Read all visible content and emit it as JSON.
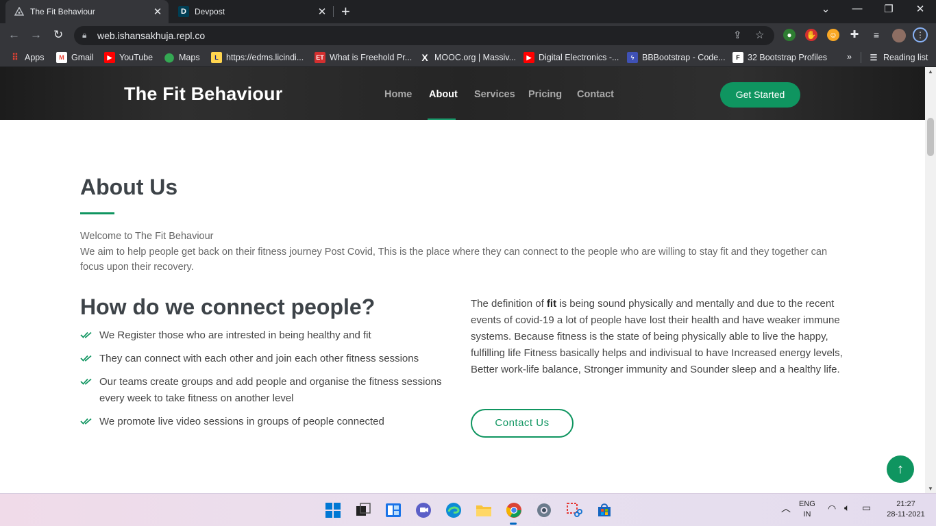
{
  "browser": {
    "tabs": [
      {
        "title": "The Fit Behaviour",
        "active": true
      },
      {
        "title": "Devpost",
        "active": false,
        "favicon_letter": "D"
      }
    ],
    "url": "web.ishansakhuja.repl.co",
    "bookmarks": [
      {
        "label": "Apps",
        "icon": "apps-grid-icon"
      },
      {
        "label": "Gmail",
        "icon": "gmail-icon"
      },
      {
        "label": "YouTube",
        "icon": "youtube-icon"
      },
      {
        "label": "Maps",
        "icon": "maps-icon"
      },
      {
        "label": "https://edms.licindi...",
        "icon": "lic-icon"
      },
      {
        "label": "What is Freehold Pr...",
        "icon": "et-icon",
        "icon_text": "ET"
      },
      {
        "label": "MOOC.org | Massiv...",
        "icon": "mooc-icon",
        "icon_text": "X"
      },
      {
        "label": "Digital Electronics -...",
        "icon": "youtube-icon"
      },
      {
        "label": "BBBootstrap - Code...",
        "icon": "bbbootstrap-icon"
      },
      {
        "label": "32 Bootstrap Profiles",
        "icon": "f-icon",
        "icon_text": "F"
      }
    ],
    "reading_list": "Reading list",
    "more_bookmarks": "»"
  },
  "site": {
    "logo": "The Fit Behaviour",
    "nav": [
      "Home",
      "About",
      "Services",
      "Pricing",
      "Contact"
    ],
    "active_nav": "About",
    "cta": "Get Started"
  },
  "about": {
    "title": "About Us",
    "intro_line1": "Welcome to The Fit Behaviour",
    "intro_line2": "We aim to help people get back on their fitness journey Post Covid, This is the place where they can connect to the people who are willing to stay fit and they together can focus upon their recovery.",
    "subtitle": "How do we connect people?",
    "points": [
      "We Register those who are intrested in being healthy and fit",
      "They can connect with each other and join each other fitness sessions",
      "Our teams create groups and add people and organise the fitness sessions every week to take fitness on another level",
      "We promote live video sessions in groups of people connected"
    ],
    "definition_pre": "The definition of ",
    "definition_bold": "fit",
    "definition_post": " is being sound physically and mentally and due to the recent events of covid-19 a lot of people have lost their health and have weaker immune systems. Because fitness is the state of being physically able to live the happy, fulfilling life Fitness basically helps and indivisual to have Increased energy levels, Better work-life balance, Stronger immunity and Sounder sleep and a healthy life.",
    "contact_button": "Contact Us"
  },
  "taskbar": {
    "lang_line1": "ENG",
    "lang_line2": "IN",
    "time": "21:27",
    "date": "28-11-2021"
  },
  "colors": {
    "brand_green": "#0f9560",
    "header_dark": "#252525",
    "chrome_dark": "#202124"
  }
}
